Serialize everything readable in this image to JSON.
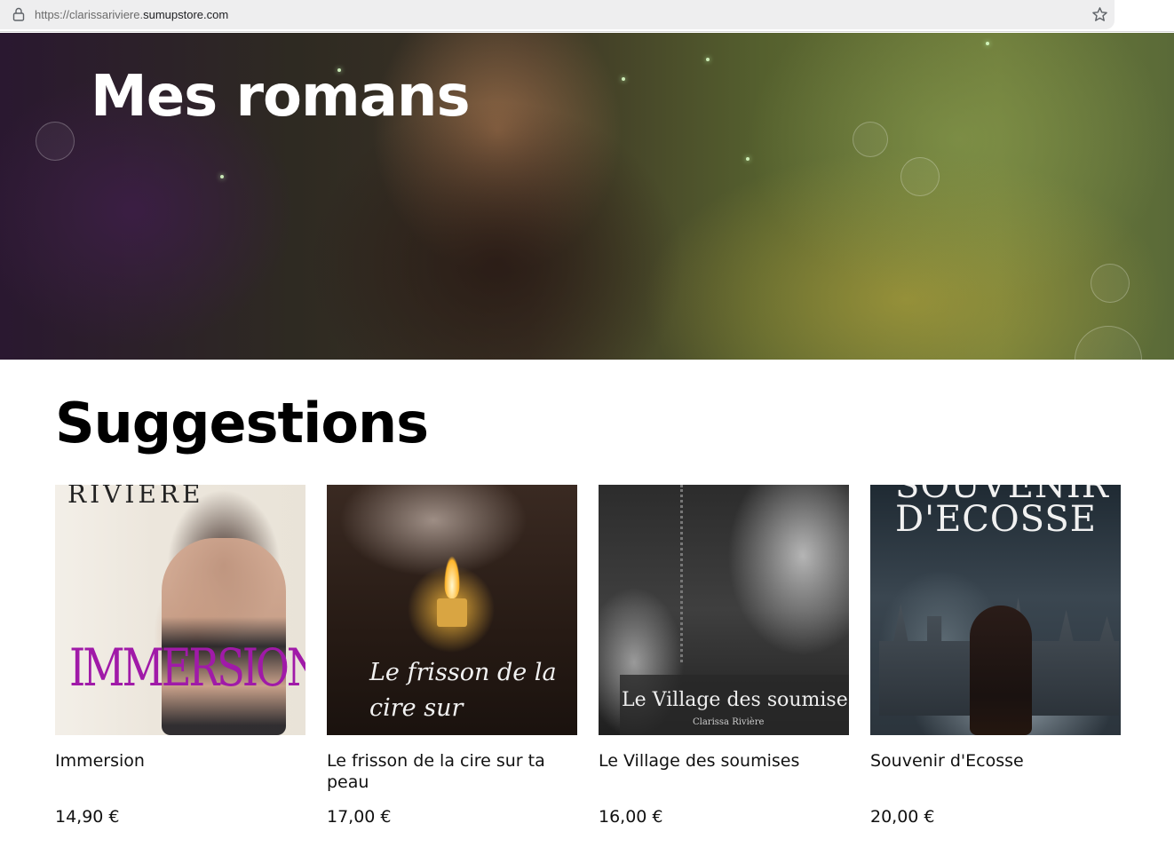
{
  "browser": {
    "url_prefix": "https://clarissariviere.",
    "url_domain": "sumupstore.com"
  },
  "hero": {
    "title": "Mes romans"
  },
  "suggestions": {
    "heading": "Suggestions",
    "products": [
      {
        "name": "Immersion",
        "price": "14,90 €",
        "cover_author": "RIVIÈRE",
        "cover_title": "IMMERSION"
      },
      {
        "name": "Le frisson de la cire sur ta peau",
        "price": "17,00 €",
        "cover_title": "Le frisson de la cire sur"
      },
      {
        "name": "Le Village des soumises",
        "price": "16,00 €",
        "cover_title": "Le Village des soumises",
        "cover_author": "Clarissa Rivière"
      },
      {
        "name": "Souvenir d'Ecosse",
        "price": "20,00 €",
        "cover_title_1": "SOUVENIR",
        "cover_title_2": "D'ECOSSE"
      }
    ]
  }
}
